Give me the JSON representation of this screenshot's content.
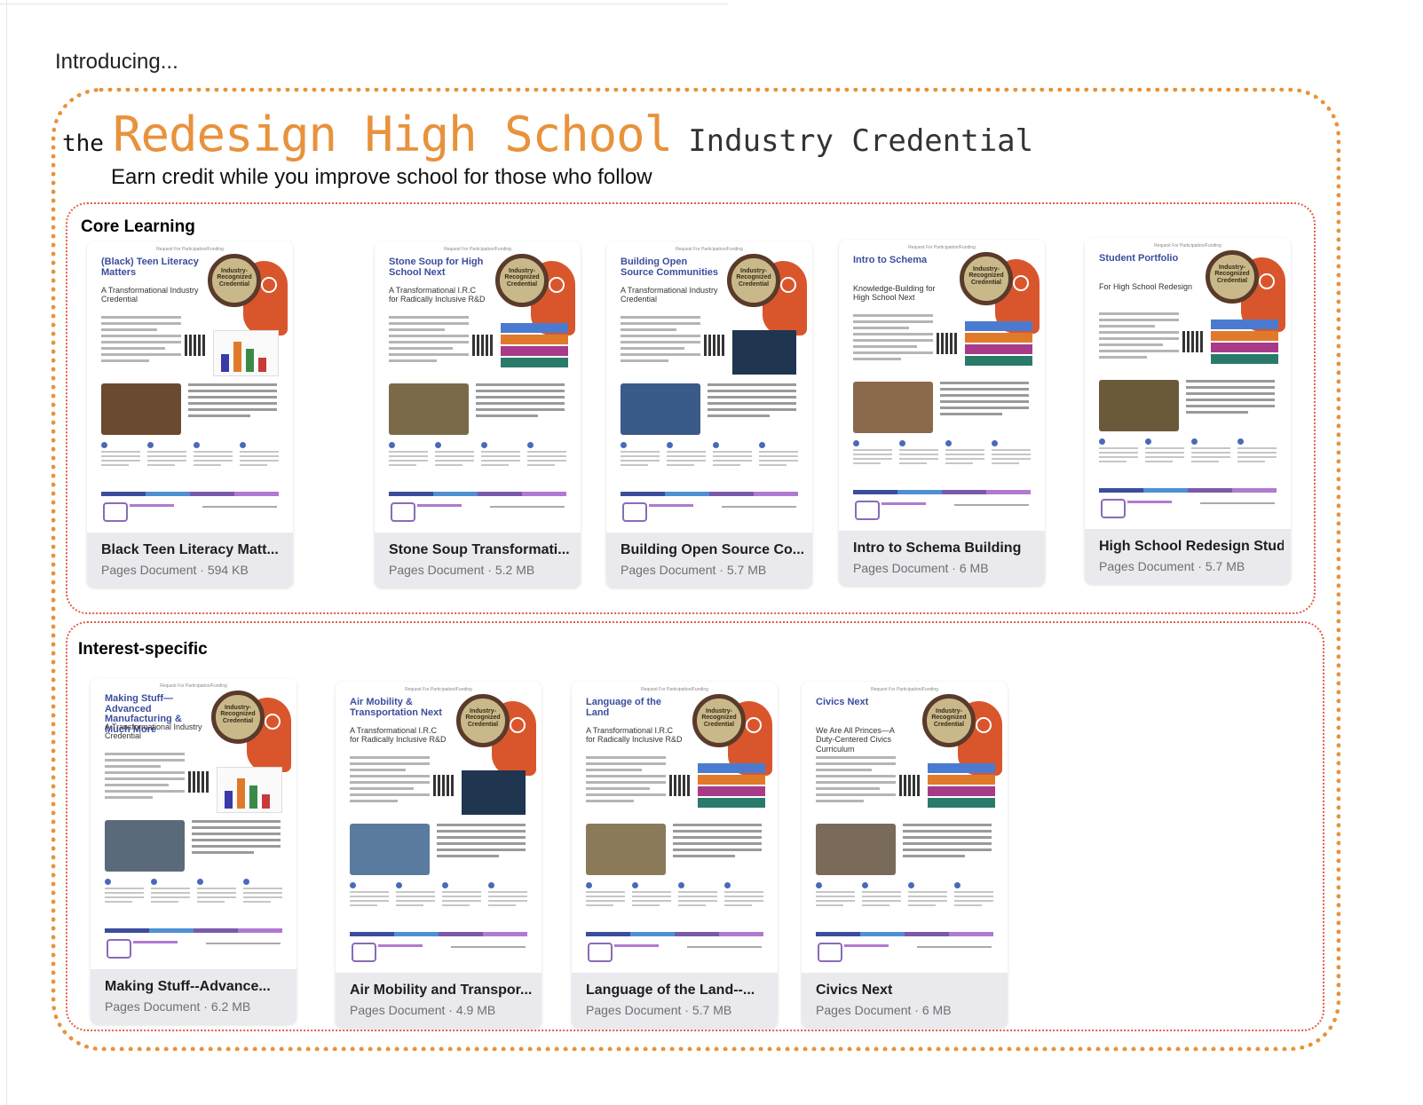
{
  "intro": "Introducing...",
  "heading": {
    "the": "the",
    "main": "Redesign High School",
    "suffix": "Industry Credential",
    "tagline": "Earn credit while you improve school for those who follow"
  },
  "colors": {
    "accent": "#e8923c",
    "section_border": "#e55c4a",
    "thumb_title": "#3b4d9c"
  },
  "thumbnail_common": {
    "rfp": "Request For Participation/Funding",
    "badge": "Industry-Recognized Credential",
    "badge_icon": "brain-gear-icon"
  },
  "sections": [
    {
      "label": "Core Learning",
      "documents": [
        {
          "thumb_title": "(Black) Teen Literacy Matters",
          "thumb_sub": "A Transformational Industry Credential",
          "name": "Black Teen Literacy Matt...",
          "kind": "Pages Document",
          "size": "594 KB"
        },
        {
          "thumb_title": "Stone Soup for High School Next",
          "thumb_sub": "A Transformational I.R.C for Radically Inclusive R&D",
          "name": "Stone Soup Transformati...",
          "kind": "Pages Document",
          "size": "5.2 MB"
        },
        {
          "thumb_title": "Building Open Source Communities",
          "thumb_sub": "A Transformational Industry Credential",
          "name": "Building Open Source Co...",
          "kind": "Pages Document",
          "size": "5.7 MB"
        },
        {
          "thumb_title": "Intro to Schema",
          "thumb_sub": "Knowledge-Building for High School Next",
          "name": "Intro to Schema Building",
          "kind": "Pages Document",
          "size": "6 MB"
        },
        {
          "thumb_title": "Student Portfolio",
          "thumb_sub": "For High School Redesign",
          "name": "High School Redesign Stud...",
          "kind": "Pages Document",
          "size": "5.7 MB"
        }
      ]
    },
    {
      "label": "Interest-specific",
      "documents": [
        {
          "thumb_title": "Making Stuff— Advanced Manufacturing & Much More",
          "thumb_sub": "A Transformational Industry Credential",
          "name": "Making Stuff--Advance...",
          "kind": "Pages Document",
          "size": "6.2 MB"
        },
        {
          "thumb_title": "Air Mobility & Transportation Next",
          "thumb_sub": "A Transformational I.R.C for Radically Inclusive R&D",
          "name": "Air Mobility and Transpor...",
          "kind": "Pages Document",
          "size": "4.9 MB"
        },
        {
          "thumb_title": "Language of the Land",
          "thumb_sub": "A Transformational I.R.C for Radically Inclusive R&D",
          "name": "Language of the Land--...",
          "kind": "Pages Document",
          "size": "5.7 MB"
        },
        {
          "thumb_title": "Civics Next",
          "thumb_sub": "We Are All Princes—A Duty-Centered Civics Curriculum",
          "name": "Civics Next",
          "kind": "Pages Document",
          "size": "6 MB"
        }
      ]
    }
  ]
}
